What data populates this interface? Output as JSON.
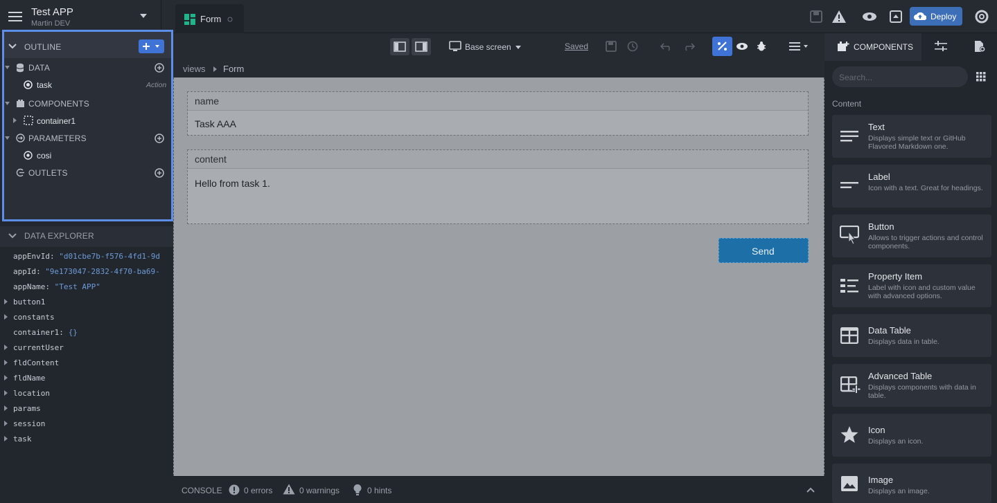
{
  "app": {
    "title": "Test APP",
    "subtitle": "Martin DEV"
  },
  "tabs": [
    {
      "label": "Form"
    }
  ],
  "topbar": {
    "deploy_label": "Deploy"
  },
  "toolbar": {
    "screen_label": "Base screen",
    "saved_label": "Saved"
  },
  "breadcrumb": [
    "views",
    "Form"
  ],
  "outline": {
    "title": "OUTLINE",
    "sections": {
      "data": "DATA",
      "components": "COMPONENTS",
      "parameters": "PARAMETERS",
      "outlets": "OUTLETS"
    },
    "items": {
      "task": "task",
      "task_badge": "Action",
      "container": "container1",
      "param": "cosi"
    }
  },
  "data_explorer": {
    "title": "DATA EXPLORER",
    "rows": [
      {
        "key": "appEnvId:",
        "value": "\"d01cbe7b-f576-4fd1-9d",
        "expandable": false
      },
      {
        "key": "appId:",
        "value": "\"9e173047-2832-4f70-ba69-",
        "expandable": false
      },
      {
        "key": "appName:",
        "value": "\"Test APP\"",
        "expandable": false
      },
      {
        "key": "button1",
        "value": "",
        "expandable": true
      },
      {
        "key": "constants",
        "value": "",
        "expandable": true
      },
      {
        "key": "container1:",
        "value": "{}",
        "expandable": false
      },
      {
        "key": "currentUser",
        "value": "",
        "expandable": true
      },
      {
        "key": "fldContent",
        "value": "",
        "expandable": true
      },
      {
        "key": "fldName",
        "value": "",
        "expandable": true
      },
      {
        "key": "location",
        "value": "",
        "expandable": true
      },
      {
        "key": "params",
        "value": "",
        "expandable": true
      },
      {
        "key": "session",
        "value": "",
        "expandable": true
      },
      {
        "key": "task",
        "value": "",
        "expandable": true
      }
    ]
  },
  "form": {
    "name_label": "name",
    "name_value": "Task AAA",
    "content_label": "content",
    "content_value": "Hello from task 1.",
    "send_label": "Send"
  },
  "console": {
    "title": "CONSOLE",
    "errors": "0 errors",
    "warnings": "0 warnings",
    "hints": "0 hints"
  },
  "components_panel": {
    "tab_label": "COMPONENTS",
    "search_placeholder": "Search...",
    "section_label": "Content",
    "cards": [
      {
        "title": "Text",
        "desc": "Displays simple text or GitHub Flavored Markdown one."
      },
      {
        "title": "Label",
        "desc": "Icon with a text. Great for headings."
      },
      {
        "title": "Button",
        "desc": "Allows to trigger actions and control components."
      },
      {
        "title": "Property Item",
        "desc": "Label with icon and custom value with advanced options."
      },
      {
        "title": "Data Table",
        "desc": "Displays data in table."
      },
      {
        "title": "Advanced Table",
        "desc": "Displays components with data in table."
      },
      {
        "title": "Icon",
        "desc": "Displays an icon."
      },
      {
        "title": "Image",
        "desc": "Displays an image."
      }
    ]
  },
  "colors": {
    "accent": "#3d6fb8",
    "highlight": "#5d8eea",
    "send": "#1d6fa8"
  }
}
